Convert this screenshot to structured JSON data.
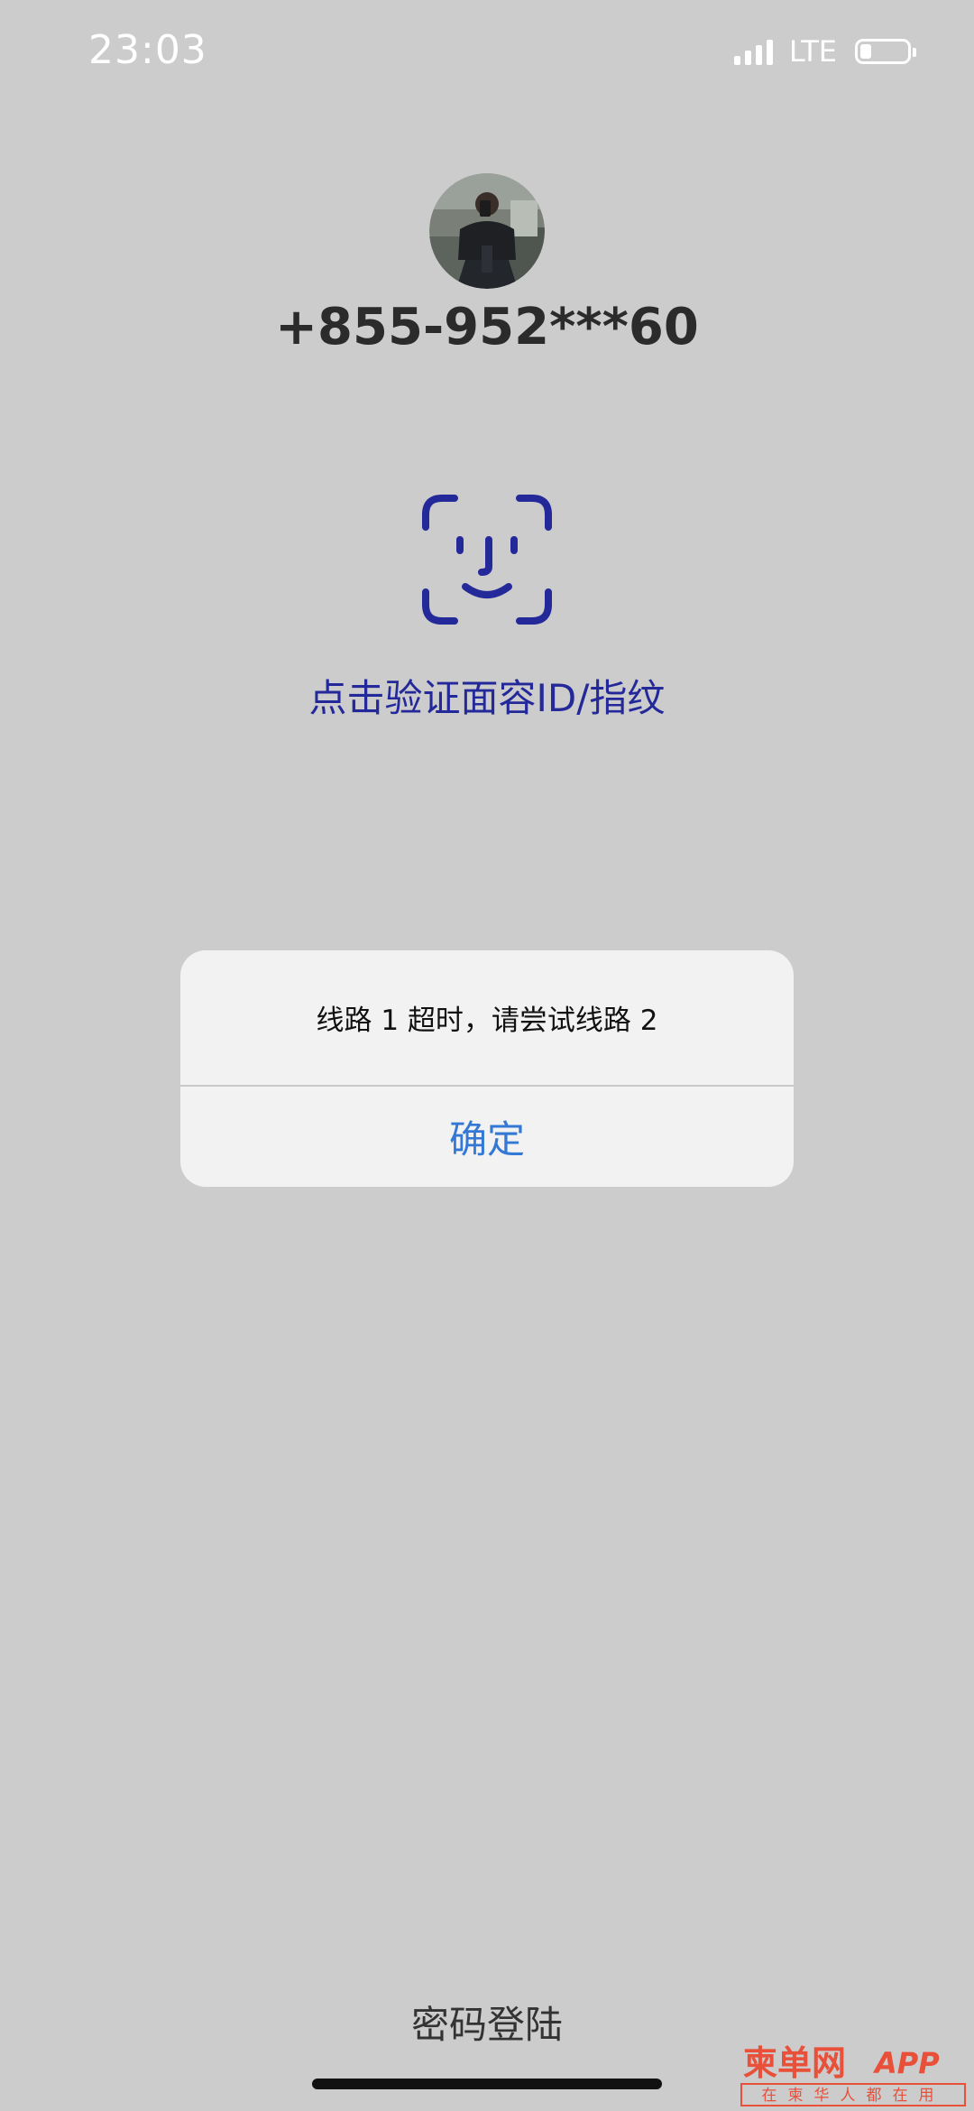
{
  "status_bar": {
    "time": "23:03",
    "network": "LTE",
    "icons": [
      "signal-icon",
      "battery-icon"
    ]
  },
  "profile": {
    "phone": "+855-952***60",
    "avatar_icon": "avatar-photo"
  },
  "biometric": {
    "icon": "face-id-icon",
    "label": "点击验证面容ID/指纹",
    "color": "#24299a"
  },
  "alert": {
    "message": "线路 1 超时，请尝试线路 2",
    "confirm_label": "确定",
    "confirm_color": "#3478d6"
  },
  "footer": {
    "password_login": "密码登陆"
  },
  "watermark": {
    "brand": "柬单网APP",
    "tagline": "在柬华人都在用",
    "color": "#e8503a"
  }
}
